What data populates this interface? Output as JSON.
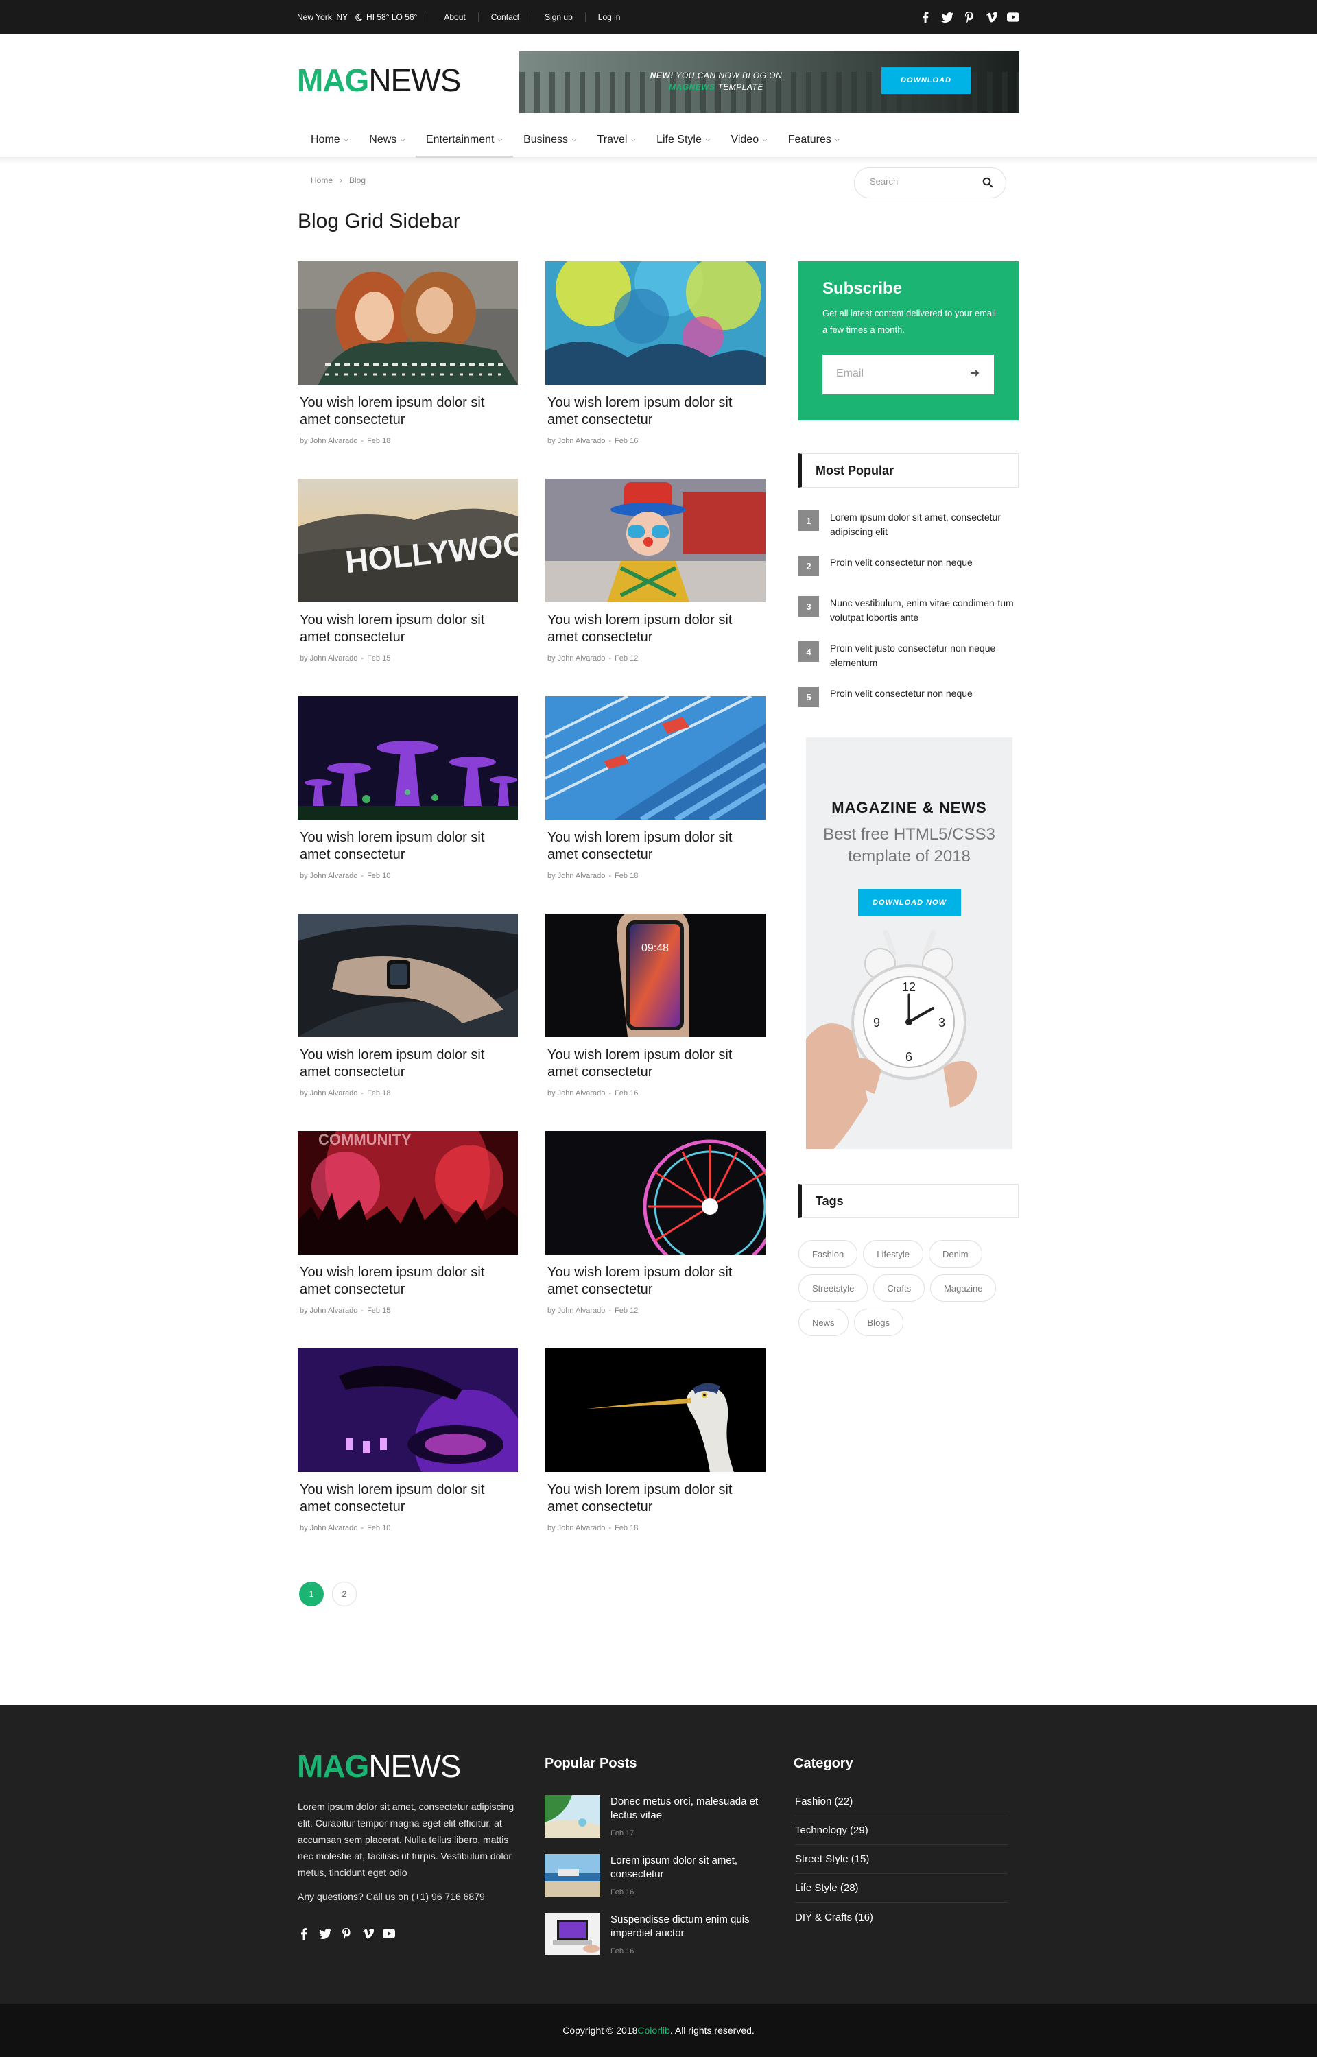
{
  "topbar": {
    "location": "New York, NY",
    "weather": "HI 58° LO 56°",
    "links": [
      "About",
      "Contact",
      "Sign up",
      "Log in"
    ],
    "social_icons": [
      "facebook-icon",
      "twitter-icon",
      "pinterest-icon",
      "vimeo-icon",
      "youtube-icon"
    ]
  },
  "header": {
    "logo_part1": "MAG",
    "logo_part2": "NEWS",
    "banner": {
      "line1_bold": "NEW!",
      "line1_rest": " YOU CAN NOW BLOG ON",
      "line2_brand": "MAGNEWS",
      "line2_rest": " TEMPLATE",
      "button": "DOWNLOAD"
    }
  },
  "nav": {
    "items": [
      "Home",
      "News",
      "Entertainment",
      "Business",
      "Travel",
      "Life Style",
      "Video",
      "Features"
    ],
    "active": "Entertainment"
  },
  "breadcrumb": {
    "home": "Home",
    "sep": "›",
    "current": "Blog"
  },
  "search": {
    "placeholder": "Search"
  },
  "page_title": "Blog Grid Sidebar",
  "posts": [
    {
      "title": "You wish lorem ipsum dolor sit amet consectetur",
      "author": "by John Alvarado",
      "date": "Feb 18"
    },
    {
      "title": "You wish lorem ipsum dolor sit amet consectetur",
      "author": "by John Alvarado",
      "date": "Feb 16"
    },
    {
      "title": "You wish lorem ipsum dolor sit amet consectetur",
      "author": "by John Alvarado",
      "date": "Feb 15"
    },
    {
      "title": "You wish lorem ipsum dolor sit amet consectetur",
      "author": "by John Alvarado",
      "date": "Feb 12"
    },
    {
      "title": "You wish lorem ipsum dolor sit amet consectetur",
      "author": "by John Alvarado",
      "date": "Feb 10"
    },
    {
      "title": "You wish lorem ipsum dolor sit amet consectetur",
      "author": "by John Alvarado",
      "date": "Feb 18"
    },
    {
      "title": "You wish lorem ipsum dolor sit amet consectetur",
      "author": "by John Alvarado",
      "date": "Feb 18"
    },
    {
      "title": "You wish lorem ipsum dolor sit amet consectetur",
      "author": "by John Alvarado",
      "date": "Feb 16"
    },
    {
      "title": "You wish lorem ipsum dolor sit amet consectetur",
      "author": "by John Alvarado",
      "date": "Feb 15"
    },
    {
      "title": "You wish lorem ipsum dolor sit amet consectetur",
      "author": "by John Alvarado",
      "date": "Feb 12"
    },
    {
      "title": "You wish lorem ipsum dolor sit amet consectetur",
      "author": "by John Alvarado",
      "date": "Feb 10"
    },
    {
      "title": "You wish lorem ipsum dolor sit amet consectetur",
      "author": "by John Alvarado",
      "date": "Feb 18"
    }
  ],
  "pagination": [
    "1",
    "2"
  ],
  "subscribe": {
    "title": "Subscribe",
    "text": "Get all latest content delivered to your email a few times a month.",
    "placeholder": "Email"
  },
  "most_popular": {
    "title": "Most Popular",
    "items": [
      {
        "num": "1",
        "text": "Lorem ipsum dolor sit amet, consectetur adipiscing elit"
      },
      {
        "num": "2",
        "text": "Proin velit consectetur non neque"
      },
      {
        "num": "3",
        "text": "Nunc vestibulum, enim vitae condimen-tum volutpat lobortis ante"
      },
      {
        "num": "4",
        "text": "Proin velit justo consectetur non neque elementum"
      },
      {
        "num": "5",
        "text": "Proin velit consectetur non neque"
      }
    ]
  },
  "ad": {
    "heading": "MAGAZINE & NEWS",
    "subheading": "Best free HTML5/CSS3 template of 2018",
    "button": "DOWNLOAD NOW"
  },
  "tags": {
    "title": "Tags",
    "items": [
      "Fashion",
      "Lifestyle",
      "Denim",
      "Streetstyle",
      "Crafts",
      "Magazine",
      "News",
      "Blogs"
    ]
  },
  "footer": {
    "logo_part1": "MAG",
    "logo_part2": "NEWS",
    "about": "Lorem ipsum dolor sit amet, consectetur adipiscing elit. Curabitur tempor magna eget elit efficitur, at accumsan sem placerat. Nulla tellus libero, mattis nec molestie at, facilisis ut turpis. Vestibulum dolor metus, tincidunt eget odio",
    "call": "Any questions? Call us on (+1) 96 716 6879",
    "popular_title": "Popular Posts",
    "popular": [
      {
        "title": "Donec metus orci, malesuada et lectus vitae",
        "date": "Feb 17"
      },
      {
        "title": "Lorem ipsum dolor sit amet, consectetur",
        "date": "Feb 16"
      },
      {
        "title": "Suspendisse dictum enim quis imperdiet auctor",
        "date": "Feb 16"
      }
    ],
    "category_title": "Category",
    "categories": [
      "Fashion (22)",
      "Technology (29)",
      "Street Style (15)",
      "Life Style (28)",
      "DIY & Crafts (16)"
    ],
    "copyright_pre": "Copyright © 2018 ",
    "copyright_brand": "Colorlib",
    "copyright_post": ". All rights reserved."
  },
  "colors": {
    "accent": "#1bb472",
    "cyan": "#00b3e6",
    "dark": "#1a1a1a",
    "footer": "#212121"
  }
}
